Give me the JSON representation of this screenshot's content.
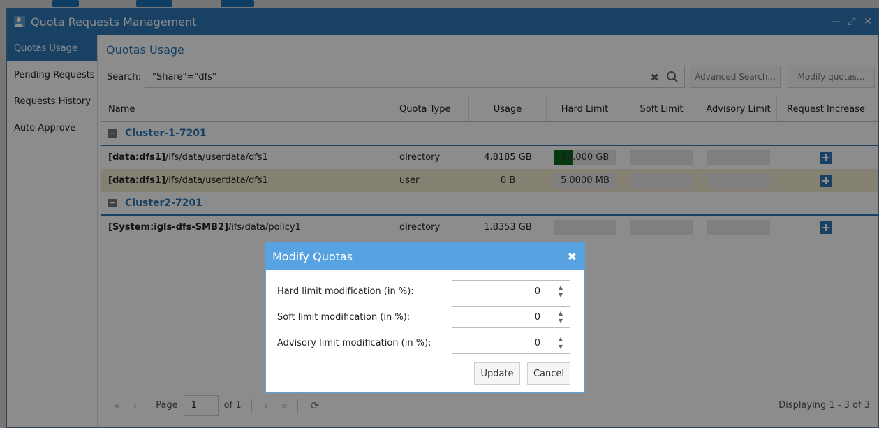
{
  "window": {
    "title": "Quota Requests Management",
    "controls": {
      "minimize": "—",
      "maximize": "⤢",
      "close": "✕"
    }
  },
  "sidebar": {
    "items": [
      {
        "label": "Quotas Usage",
        "active": true
      },
      {
        "label": "Pending Requests",
        "active": false
      },
      {
        "label": "Requests History",
        "active": false
      },
      {
        "label": "Auto Approve",
        "active": false
      }
    ]
  },
  "main": {
    "title": "Quotas Usage",
    "search_label": "Search:",
    "search_value": "\"Share\"=\"dfs\"",
    "advanced_search": "Advanced Search...",
    "modify_quotas": "Modify quotas..."
  },
  "table": {
    "columns": [
      "Name",
      "Quota Type",
      "Usage",
      "Hard Limit",
      "Soft Limit",
      "Advisory Limit",
      "Request Increase"
    ],
    "groups": [
      {
        "name": "Cluster-1-7201",
        "rows": [
          {
            "name_bold": "[data:dfs1]",
            "name_rest": "/ifs/data/userdata/dfs1",
            "type": "directory",
            "usage": "4.8185 GB",
            "hard": "10.000 GB",
            "hard_fill": 0.3,
            "soft": "",
            "advisory": "",
            "highlight": false
          },
          {
            "name_bold": "[data:dfs1]",
            "name_rest": "/ifs/data/userdata/dfs1",
            "type": "user",
            "usage": "0 B",
            "hard": "5.0000 MB",
            "hard_fill": 0,
            "soft": "",
            "advisory": "",
            "highlight": true
          }
        ]
      },
      {
        "name": "Cluster2-7201",
        "rows": [
          {
            "name_bold": "[System:igls-dfs-SMB2]",
            "name_rest": "/ifs/data/policy1",
            "type": "directory",
            "usage": "1.8353 GB",
            "hard": "",
            "hard_fill": 0,
            "soft": "",
            "advisory": "",
            "highlight": false
          }
        ]
      }
    ]
  },
  "pager": {
    "page_label": "Page",
    "page_value": "1",
    "of_label": "of 1",
    "status": "Displaying 1 - 3 of 3"
  },
  "dialog": {
    "title": "Modify Quotas",
    "fields": [
      {
        "label": "Hard limit modification (in %):",
        "value": "0"
      },
      {
        "label": "Soft limit modification (in %):",
        "value": "0"
      },
      {
        "label": "Advisory limit modification (in %):",
        "value": "0"
      }
    ],
    "update": "Update",
    "cancel": "Cancel"
  },
  "colors": {
    "accent": "#2c77b6",
    "dialog_header": "#57a2e0",
    "usage_fill": "#0a6a1f",
    "highlight_row": "#f2ebd0"
  }
}
